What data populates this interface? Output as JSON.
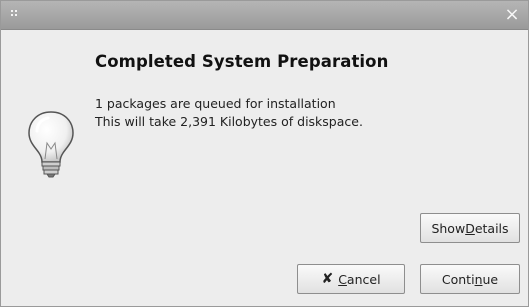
{
  "dialog": {
    "heading": "Completed System Preparation",
    "line1": "1 packages are queued for installation",
    "line2": "This will take 2,391 Kilobytes of diskspace."
  },
  "titlebar": {
    "close_glyph": "×"
  },
  "buttons": {
    "details_pre": "Show ",
    "details_mnemonic": "D",
    "details_post": "etails",
    "cancel_mnemonic": "C",
    "cancel_post": "ancel",
    "continue_pre": "Conti",
    "continue_mnemonic": "n",
    "continue_post": "ue"
  },
  "icons": {
    "grip": "grip-icon",
    "close": "close-icon",
    "bulb": "lightbulb-icon",
    "cancel": "cancel-x-icon"
  }
}
